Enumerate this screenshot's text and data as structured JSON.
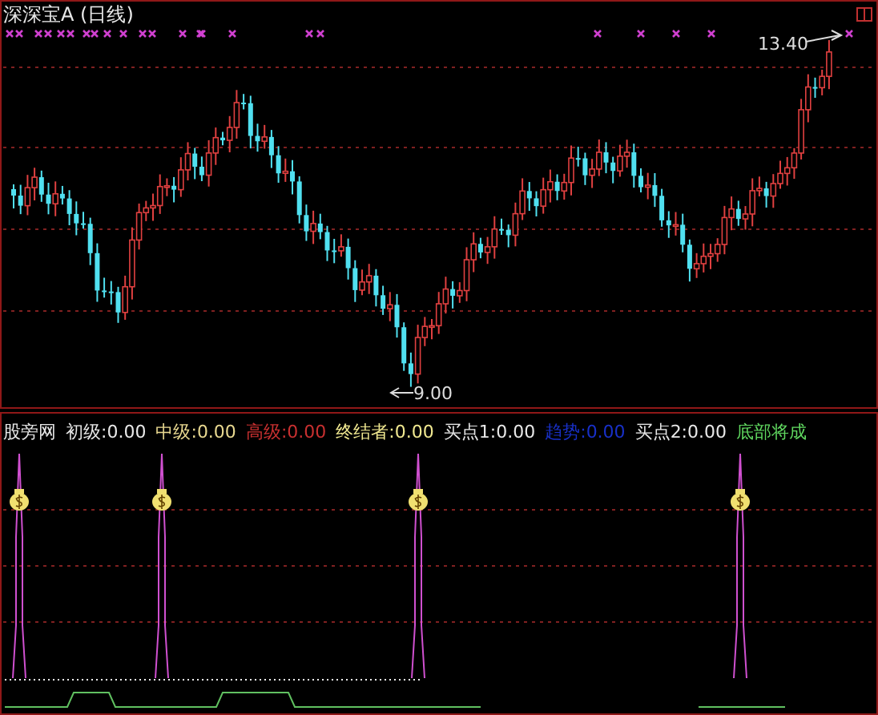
{
  "chart": {
    "title": "深深宝A (日线)",
    "high_label": "13.40",
    "low_label": "9.00"
  },
  "indicator": {
    "name": "股旁网",
    "legend": [
      {
        "label": "初级:",
        "value": "0.00",
        "color": "#e8e8e8"
      },
      {
        "label": "中级:",
        "value": "0.00",
        "color": "#e8d890"
      },
      {
        "label": "高级:",
        "value": "0.00",
        "color": "#c83030"
      },
      {
        "label": "终结者:",
        "value": "0.00",
        "color": "#f0e890"
      },
      {
        "label": "买点1:",
        "value": "0.00",
        "color": "#e8e8e8"
      },
      {
        "label": "趋势:",
        "value": "0.00",
        "color": "#1830c8"
      },
      {
        "label": "买点2:",
        "value": "0.00",
        "color": "#e8e8e8"
      },
      {
        "label": "底部将成",
        "color": "#60d860"
      }
    ]
  }
}
